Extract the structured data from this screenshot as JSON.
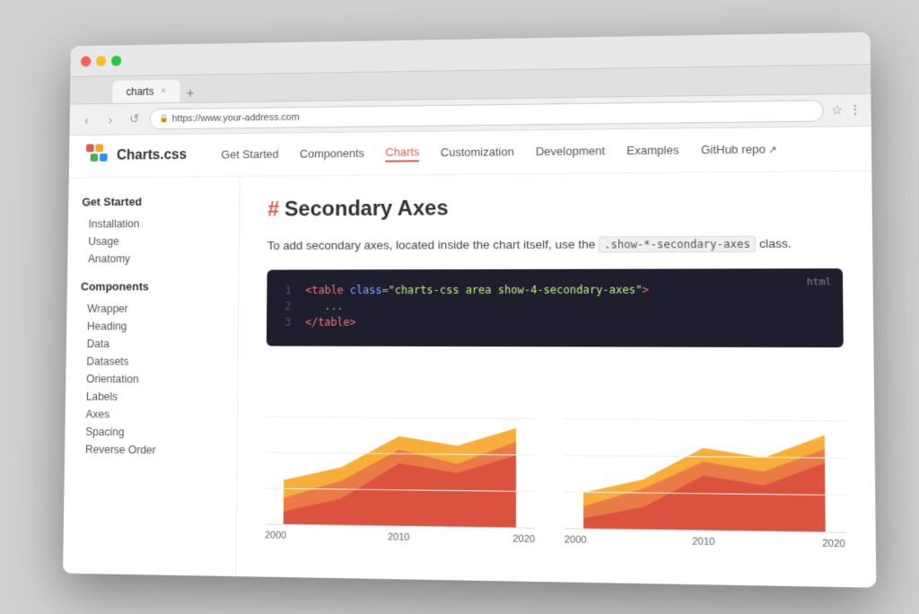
{
  "browser": {
    "tab_label": "charts",
    "tab_close": "×",
    "address": "https://www.your-address.com",
    "star_icon": "☆",
    "more_icon": "⋮",
    "back_icon": "‹",
    "forward_icon": "›",
    "refresh_icon": "↺"
  },
  "site": {
    "logo_text": "Charts.css",
    "nav": [
      {
        "label": "Get Started",
        "active": false
      },
      {
        "label": "Components",
        "active": false
      },
      {
        "label": "Charts",
        "active": true
      },
      {
        "label": "Customization",
        "active": false
      },
      {
        "label": "Development",
        "active": false
      },
      {
        "label": "Examples",
        "active": false
      },
      {
        "label": "GitHub repo",
        "active": false,
        "external": true
      }
    ]
  },
  "sidebar": {
    "section1": {
      "title": "Get Started",
      "items": [
        "Installation",
        "Usage",
        "Anatomy"
      ]
    },
    "section2": {
      "title": "Components",
      "items": [
        "Wrapper",
        "Heading",
        "Data",
        "Datasets",
        "Orientation",
        "Labels",
        "Axes",
        "Spacing",
        "Reverse Order"
      ]
    }
  },
  "main": {
    "page_title": "Secondary Axes",
    "hash": "#",
    "description_before": "To add secondary axes, located inside the chart itself, use the",
    "inline_code": ".show-*-secondary-axes",
    "description_after": "class.",
    "code_lang": "html",
    "code_lines": [
      {
        "num": "1",
        "content": "<table class=\"charts-css area show-4-secondary-axes\">"
      },
      {
        "num": "2",
        "content": "   ..."
      },
      {
        "num": "3",
        "content": "</table>"
      }
    ],
    "chart1": {
      "labels": [
        "2000",
        "2010",
        "2020"
      ]
    },
    "chart2": {
      "labels": [
        "2000",
        "2010",
        "2020"
      ]
    }
  }
}
